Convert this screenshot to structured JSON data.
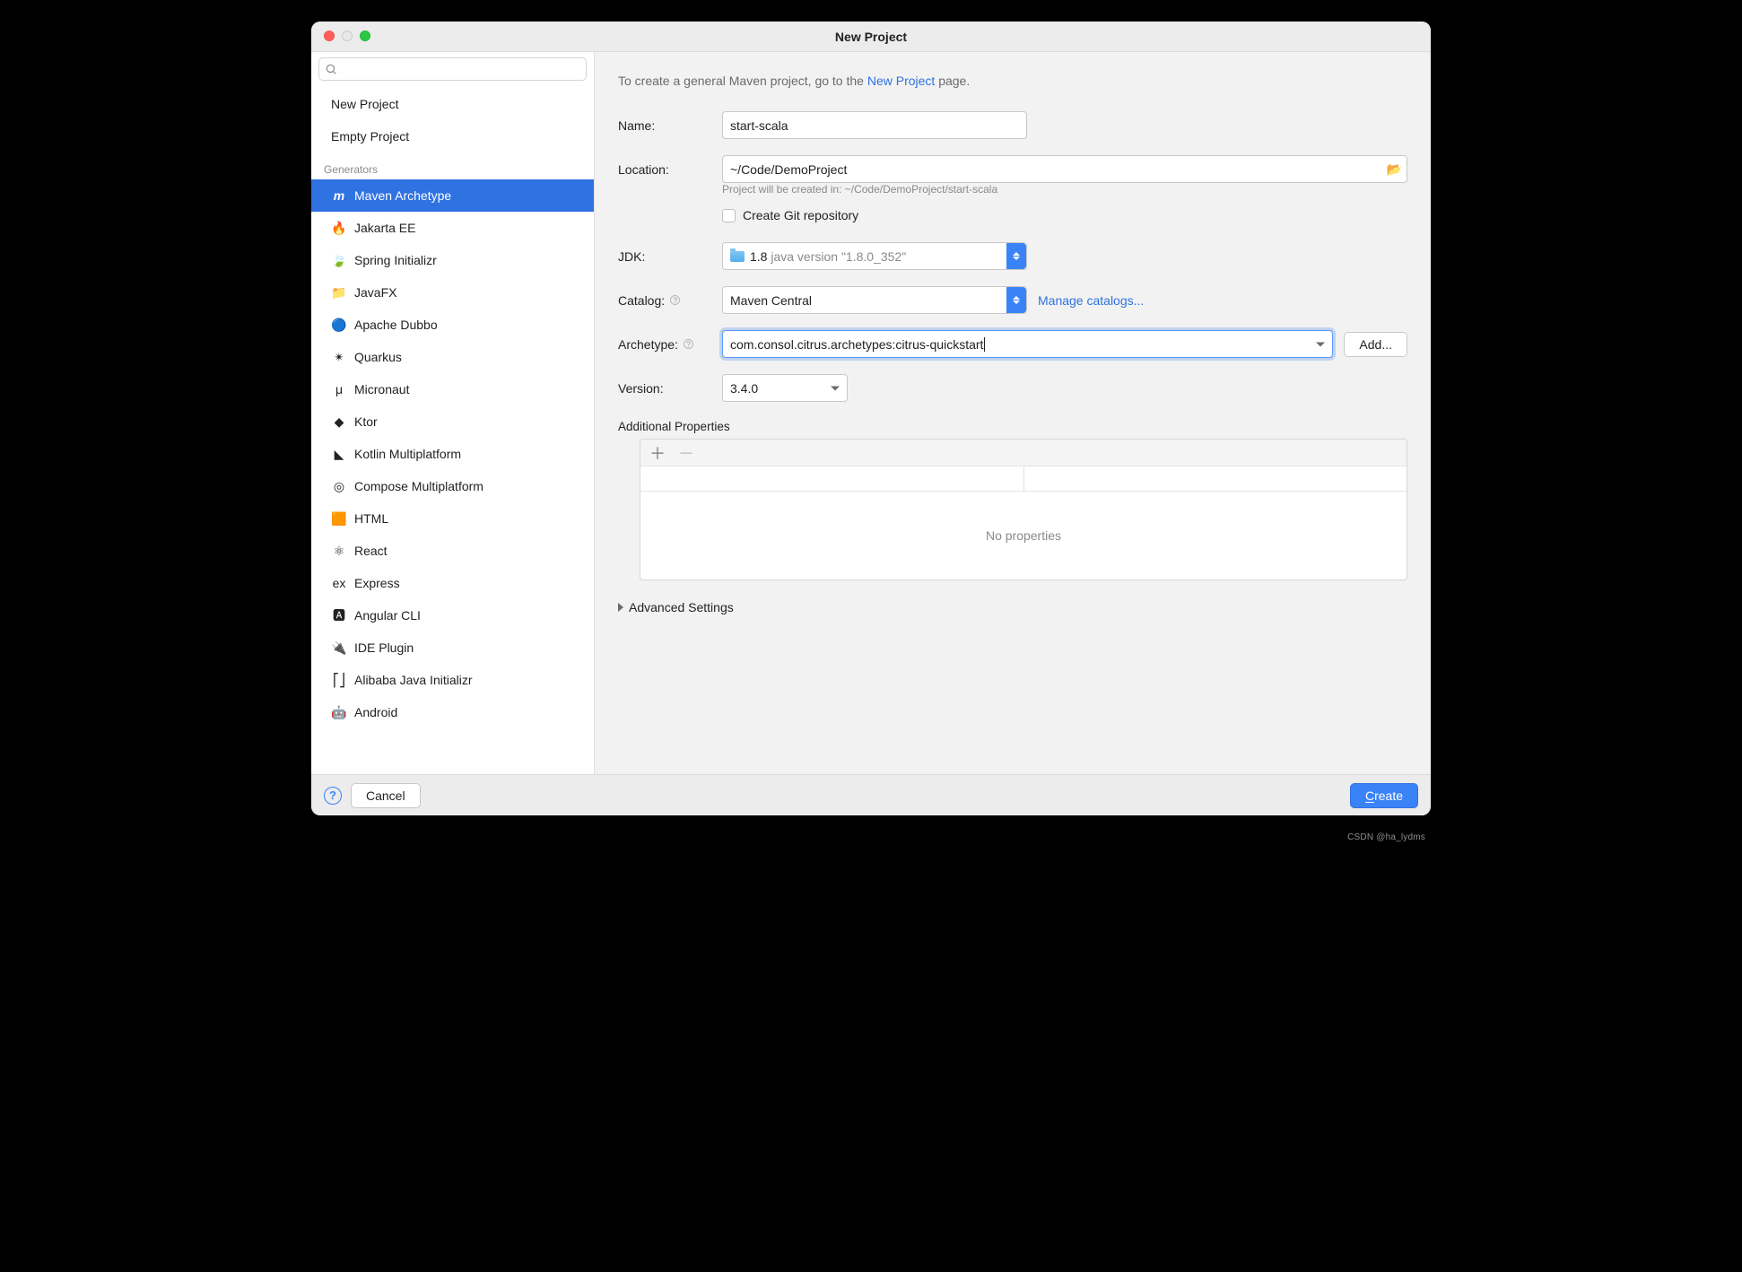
{
  "window": {
    "title": "New Project"
  },
  "sidebar": {
    "top_items": [
      "New Project",
      "Empty Project"
    ],
    "generators_label": "Generators",
    "generators": [
      {
        "label": "Maven Archetype",
        "icon": "m",
        "selected": true
      },
      {
        "label": "Jakarta EE",
        "icon": "🔥"
      },
      {
        "label": "Spring Initializr",
        "icon": "🍃"
      },
      {
        "label": "JavaFX",
        "icon": "📁"
      },
      {
        "label": "Apache Dubbo",
        "icon": "🔵"
      },
      {
        "label": "Quarkus",
        "icon": "✴"
      },
      {
        "label": "Micronaut",
        "icon": "μ"
      },
      {
        "label": "Ktor",
        "icon": "◆"
      },
      {
        "label": "Kotlin Multiplatform",
        "icon": "◣"
      },
      {
        "label": "Compose Multiplatform",
        "icon": "◎"
      },
      {
        "label": "HTML",
        "icon": "🟧"
      },
      {
        "label": "React",
        "icon": "⚛"
      },
      {
        "label": "Express",
        "icon": "ex"
      },
      {
        "label": "Angular CLI",
        "icon": "🅰"
      },
      {
        "label": "IDE Plugin",
        "icon": "🔌"
      },
      {
        "label": "Alibaba Java Initializr",
        "icon": "⎡⎦"
      },
      {
        "label": "Android",
        "icon": "🤖"
      }
    ]
  },
  "intro": {
    "prefix": "To create a general Maven project, go to the ",
    "link": "New Project",
    "suffix": " page."
  },
  "form": {
    "name_label": "Name:",
    "name_value": "start-scala",
    "location_label": "Location:",
    "location_value": "~/Code/DemoProject",
    "location_hint": "Project will be created in: ~/Code/DemoProject/start-scala",
    "git_label": "Create Git repository",
    "jdk_label": "JDK:",
    "jdk_value": "1.8",
    "jdk_detail": "java version \"1.8.0_352\"",
    "catalog_label": "Catalog:",
    "catalog_value": "Maven Central",
    "manage_catalogs": "Manage catalogs...",
    "archetype_label": "Archetype:",
    "archetype_value": "com.consol.citrus.archetypes:citrus-quickstart",
    "add_label": "Add...",
    "version_label": "Version:",
    "version_value": "3.4.0",
    "additional_label": "Additional Properties",
    "no_properties": "No properties",
    "advanced_label": "Advanced Settings"
  },
  "footer": {
    "cancel": "Cancel",
    "create": "Create"
  },
  "watermark": "CSDN @ha_lydms"
}
